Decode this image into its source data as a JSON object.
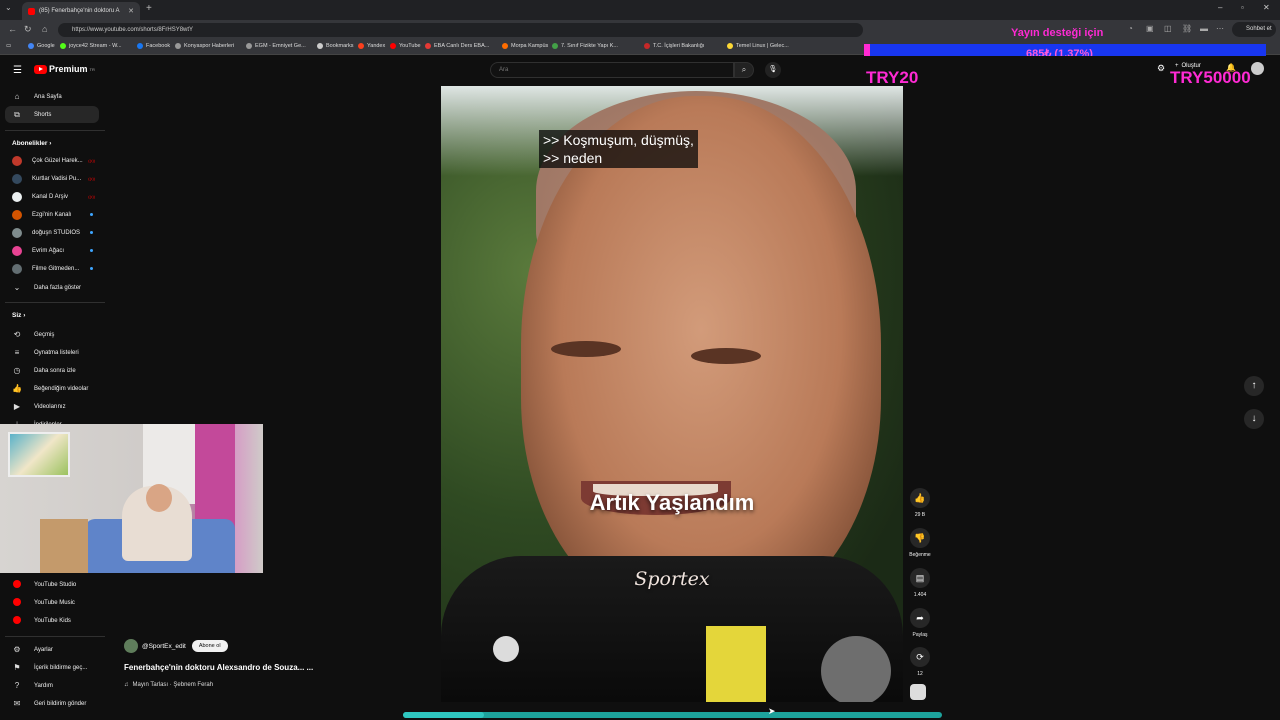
{
  "browser": {
    "tab_title": "(85) Fenerbahçe'nin doktoru A",
    "url": "https://www.youtube.com/shorts/8FrHSY8wtY",
    "profile_button": "Sohbet et",
    "bookmarks": [
      {
        "label": "Google",
        "color": "#4285f4"
      },
      {
        "label": "joyce42 Stream - W...",
        "color": "#53fc18"
      },
      {
        "label": "Facebook",
        "color": "#1877f2"
      },
      {
        "label": "Konyaspor Haberleri",
        "color": "#999999"
      },
      {
        "label": "EGM - Emniyet Ge...",
        "color": "#999999"
      },
      {
        "label": "Bookmarks",
        "color": "#cccccc"
      },
      {
        "label": "Yandex",
        "color": "#fc3f1d"
      },
      {
        "label": "YouTube",
        "color": "#ff0000"
      },
      {
        "label": "EBA Canlı Ders EBA...",
        "color": "#e53935"
      },
      {
        "label": "Morpa Kampüs",
        "color": "#ff6d00"
      },
      {
        "label": "7. Sınıf Fizikte Yapı K...",
        "color": "#43a047"
      },
      {
        "label": "T.C. İçişleri Bakanlığı",
        "color": "#c62828"
      },
      {
        "label": "Temel Linux | Gelec...",
        "color": "#fdd835"
      }
    ]
  },
  "youtube": {
    "logo_text": "Premium",
    "logo_sup": "TR",
    "search_placeholder": "Ara",
    "create_label": "Oluştur"
  },
  "sidebar": {
    "main": [
      {
        "label": "Ana Sayfa",
        "icon": "home-icon"
      },
      {
        "label": "Shorts",
        "icon": "shorts-icon"
      }
    ],
    "subscriptions_heading": "Abonelikler",
    "subscriptions": [
      {
        "label": "Çok Güzel Harek...",
        "color": "#c0392b",
        "status": "live"
      },
      {
        "label": "Kurtlar Vadisi Pu...",
        "color": "#34495e",
        "status": "live"
      },
      {
        "label": "Kanal D Arşiv",
        "color": "#ecf0f1",
        "status": "live"
      },
      {
        "label": "Ezgi'nin Kanalı",
        "color": "#d35400",
        "status": "new"
      },
      {
        "label": "doğuşn STUDIOS",
        "color": "#7f8c8d",
        "status": "new"
      },
      {
        "label": "Evrim Ağacı",
        "color": "#e84393",
        "status": "new"
      },
      {
        "label": "Filme Gitmeden...",
        "color": "#636e72",
        "status": "new"
      }
    ],
    "show_more": "Daha fazla göster",
    "you_heading": "Siz",
    "you": [
      {
        "label": "Geçmiş",
        "icon": "history-icon"
      },
      {
        "label": "Oynatma listeleri",
        "icon": "playlist-icon"
      },
      {
        "label": "Daha sonra izle",
        "icon": "clock-icon"
      },
      {
        "label": "Beğendiğim videolar",
        "icon": "thumbs-up-icon"
      },
      {
        "label": "Videolarınız",
        "icon": "video-icon"
      },
      {
        "label": "İndirilenler",
        "icon": "download-icon"
      }
    ],
    "more": [
      {
        "label": "YouTube Studio",
        "color": "#ff0000"
      },
      {
        "label": "YouTube Music",
        "color": "#ff0000"
      },
      {
        "label": "YouTube Kids",
        "color": "#ff0000"
      }
    ],
    "settings": [
      {
        "label": "Ayarlar",
        "icon": "gear-icon"
      },
      {
        "label": "İçerik bildirme geç...",
        "icon": "flag-icon"
      },
      {
        "label": "Yardım",
        "icon": "help-icon"
      },
      {
        "label": "Geri bildirim gönder",
        "icon": "feedback-icon"
      }
    ]
  },
  "short": {
    "captions": ">> Koşmuşum, düşmüş,\n>> neden",
    "overlay_title": "Artık Yaşlandım",
    "watermark": "Sportex",
    "channel": "@SportEx_edit",
    "subscribe_label": "Abone ol",
    "title": "Fenerbahçe'nin doktoru Alexsandro de Souza... ...",
    "sound": "Mayın Tarlası · Şebnem Ferah",
    "actions": [
      {
        "label": "29 B",
        "icon": "thumbs-up-icon"
      },
      {
        "label": "Beğenme",
        "icon": "thumbs-down-icon"
      },
      {
        "label": "1.404",
        "icon": "comment-icon"
      },
      {
        "label": "Paylaş",
        "icon": "share-icon"
      },
      {
        "label": "12",
        "icon": "remix-icon"
      }
    ],
    "progress_fraction": 0.15
  },
  "stream_overlay": {
    "goal_text": "Yayın desteği için",
    "amount_text": "685₺ (1.37%)",
    "min_label": "TRY20",
    "max_label": "TRY50000",
    "progress_fraction": 0.0137
  }
}
